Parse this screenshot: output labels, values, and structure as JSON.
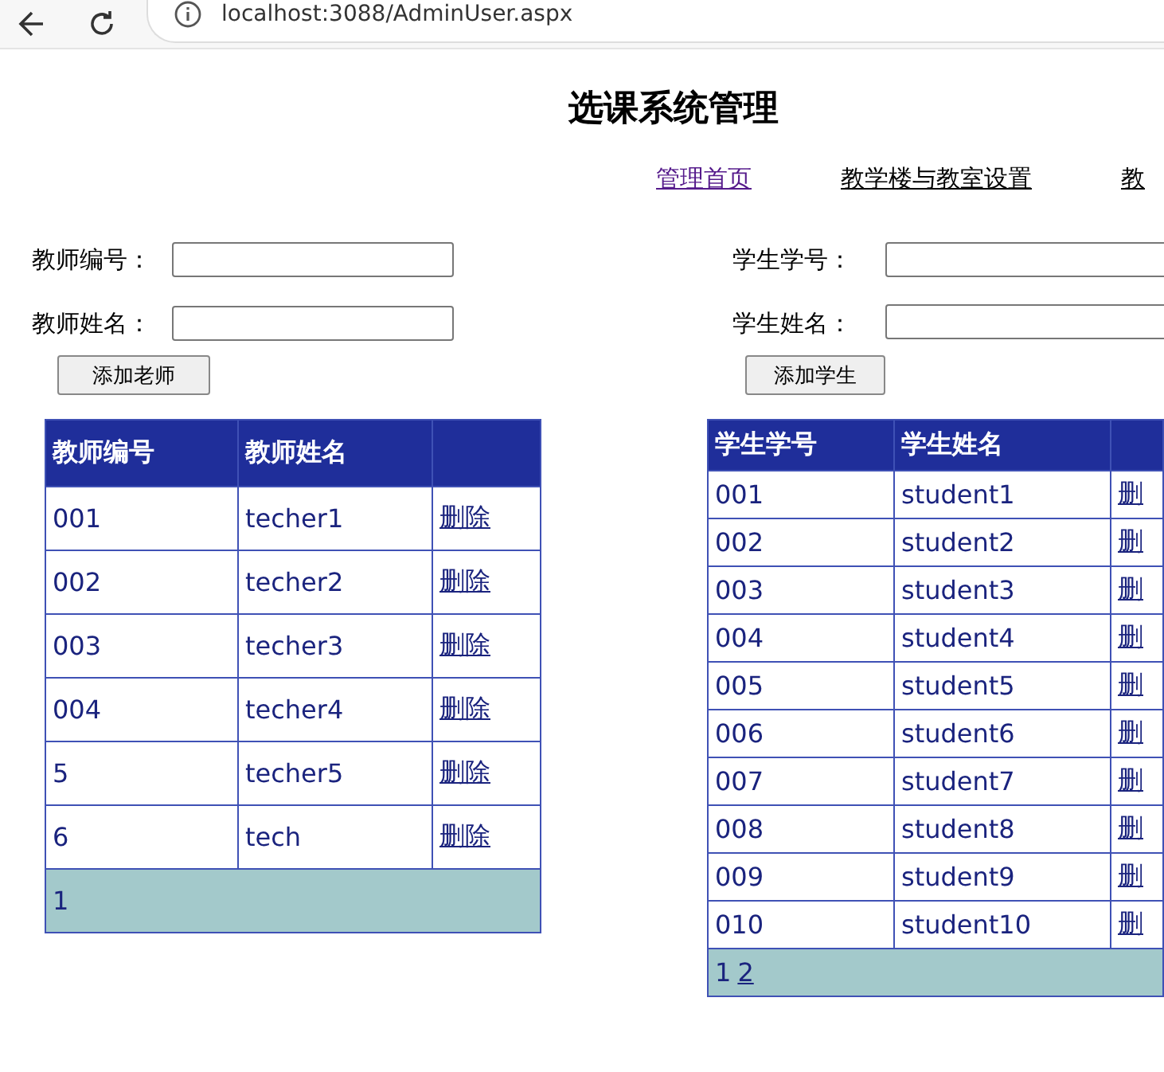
{
  "browser": {
    "url": "localhost:3088/AdminUser.aspx"
  },
  "page_title": "选课系统管理",
  "nav_links": [
    {
      "label": "管理首页",
      "visited": true
    },
    {
      "label": "教学楼与教室设置",
      "visited": false
    },
    {
      "label": "教",
      "visited": false
    }
  ],
  "teacher_form": {
    "fields": [
      {
        "label": "教师编号："
      },
      {
        "label": "教师姓名："
      }
    ],
    "button": "添加老师"
  },
  "student_form": {
    "fields": [
      {
        "label": "学生学号："
      },
      {
        "label": "学生姓名："
      }
    ],
    "button": "添加学生"
  },
  "teacher_table": {
    "columns": [
      "教师编号",
      "教师姓名"
    ],
    "rows": [
      {
        "id": "001",
        "name": "techer1",
        "action": "删除"
      },
      {
        "id": "002",
        "name": "techer2",
        "action": "删除"
      },
      {
        "id": "003",
        "name": "techer3",
        "action": "删除"
      },
      {
        "id": "004",
        "name": "techer4",
        "action": "删除"
      },
      {
        "id": "5",
        "name": "techer5",
        "action": "删除"
      },
      {
        "id": "6",
        "name": "tech",
        "action": "删除"
      }
    ],
    "pager": [
      {
        "label": "1",
        "selected": true
      }
    ]
  },
  "student_table": {
    "columns": [
      "学生学号",
      "学生姓名"
    ],
    "rows": [
      {
        "id": "001",
        "name": "student1",
        "action": "删"
      },
      {
        "id": "002",
        "name": "student2",
        "action": "删"
      },
      {
        "id": "003",
        "name": "student3",
        "action": "删"
      },
      {
        "id": "004",
        "name": "student4",
        "action": "删"
      },
      {
        "id": "005",
        "name": "student5",
        "action": "删"
      },
      {
        "id": "006",
        "name": "student6",
        "action": "删"
      },
      {
        "id": "007",
        "name": "student7",
        "action": "删"
      },
      {
        "id": "008",
        "name": "student8",
        "action": "删"
      },
      {
        "id": "009",
        "name": "student9",
        "action": "删"
      },
      {
        "id": "010",
        "name": "student10",
        "action": "删"
      }
    ],
    "pager": [
      {
        "label": "1",
        "selected": true
      },
      {
        "label": "2",
        "selected": false
      }
    ]
  }
}
